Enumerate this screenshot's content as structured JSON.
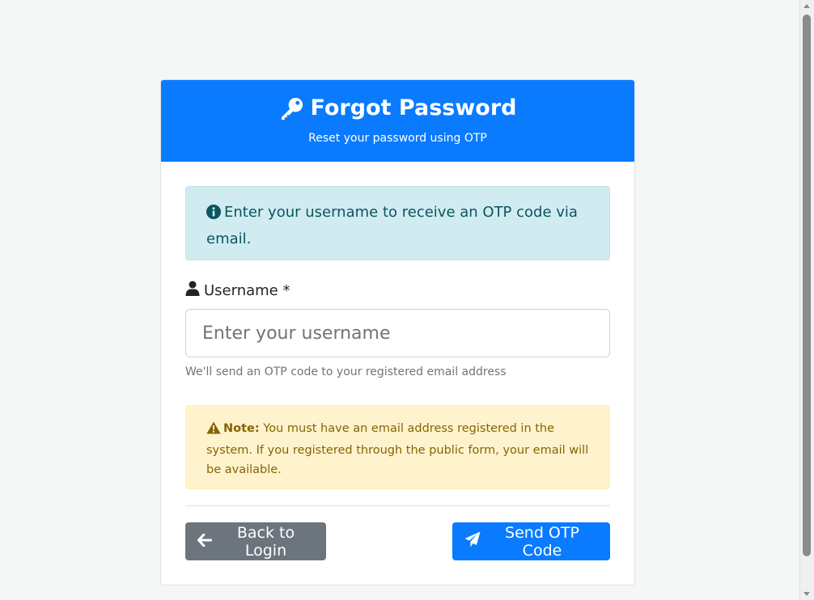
{
  "header": {
    "title": "Forgot Password",
    "subtitle": "Reset your password using OTP",
    "icon": "key-icon"
  },
  "info_alert": {
    "icon": "info-circle-icon",
    "text": "Enter your username to receive an OTP code via email."
  },
  "form": {
    "username_label": "Username *",
    "username_icon": "user-icon",
    "username_placeholder": "Enter your username",
    "username_value": "",
    "help_text": "We'll send an OTP code to your registered email address"
  },
  "warning_alert": {
    "icon": "warning-triangle-icon",
    "label": "Note:",
    "text": " You must have an email address registered in the system. If you registered through the public form, your email will be available."
  },
  "buttons": {
    "back_label": "Back to Login",
    "back_icon": "arrow-left-icon",
    "send_label": "Send OTP Code",
    "send_icon": "paper-plane-icon"
  },
  "colors": {
    "primary": "#0a7bff",
    "secondary": "#6c757d",
    "info_bg": "#d1ecf1",
    "warning_bg": "#fff3cd"
  }
}
